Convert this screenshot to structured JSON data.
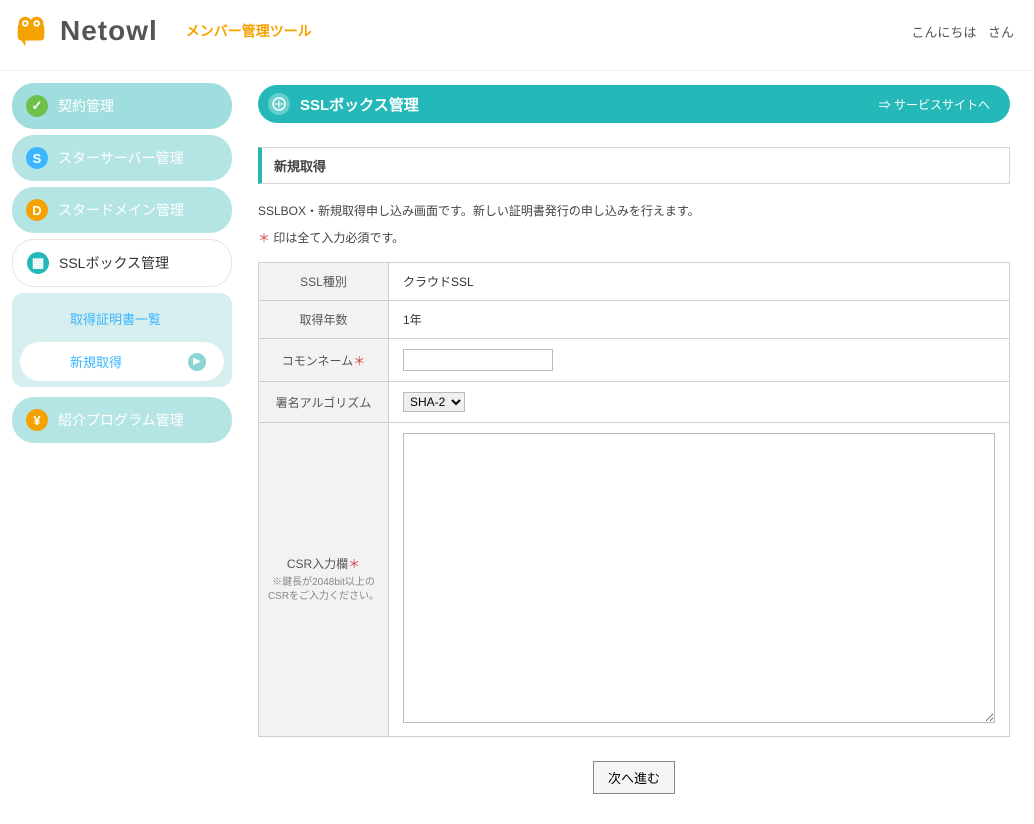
{
  "header": {
    "brand": "Netowl",
    "subtitle": "メンバー管理ツール",
    "greeting_prefix": "こんにちは",
    "username": "        ",
    "greeting_suffix": "さん"
  },
  "sidebar": {
    "items": [
      {
        "label": "契約管理",
        "icon_letter": "✓"
      },
      {
        "label": "スターサーバー管理",
        "icon_letter": "S"
      },
      {
        "label": "スタードメイン管理",
        "icon_letter": "D"
      },
      {
        "label": "SSLボックス管理",
        "icon_letter": "▦"
      },
      {
        "label": "紹介プログラム管理",
        "icon_letter": "¥"
      }
    ],
    "sub": [
      {
        "label": "取得証明書一覧"
      },
      {
        "label": "新規取得"
      }
    ]
  },
  "page": {
    "title": "SSLボックス管理",
    "service_link": "⇒ サービスサイトへ",
    "section": "新規取得",
    "desc": "SSLBOX・新規取得申し込み画面です。新しい証明書発行の申し込みを行えます。",
    "required_note": "印は全て入力必須です。",
    "form": {
      "ssl_type_label": "SSL種別",
      "ssl_type_value": "クラウドSSL",
      "years_label": "取得年数",
      "years_value": "1年",
      "common_name_label": "コモンネーム",
      "common_name_value": "",
      "algo_label": "署名アルゴリズム",
      "algo_value": "SHA-2",
      "csr_label": "CSR入力欄",
      "csr_note": "※鍵長が2048bit以上のCSRをご入力ください。",
      "csr_value": ""
    },
    "next_button": "次へ進む"
  }
}
